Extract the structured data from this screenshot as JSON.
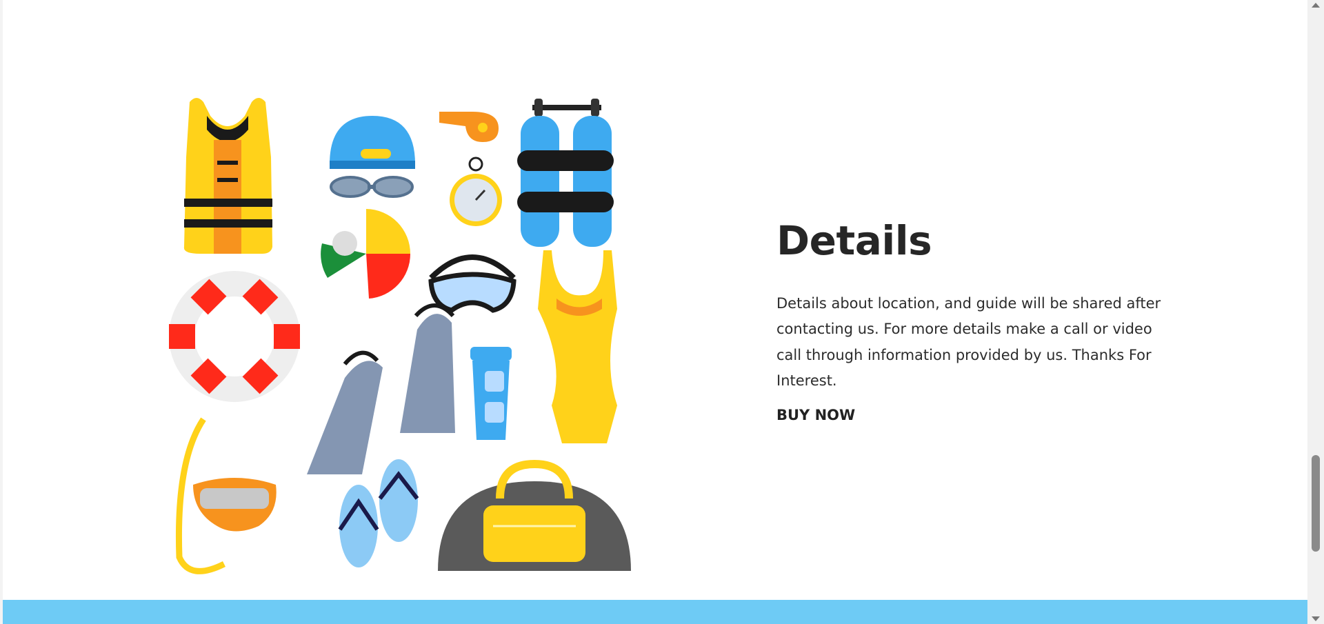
{
  "details": {
    "title": "Details",
    "body": "Details about location, and guide will be shared after contacting us. For more details make a call or video call through information provided by us. Thanks For Interest.",
    "cta_label": "BUY NOW"
  },
  "illustration": {
    "icons": [
      "life-vest-icon",
      "swim-cap-icon",
      "goggles-icon",
      "whistle-icon",
      "stopwatch-icon",
      "scuba-tanks-icon",
      "beach-ball-icon",
      "swim-mask-icon",
      "swimsuit-icon",
      "life-ring-icon",
      "fins-icon",
      "water-bottle-icon",
      "snorkel-icon",
      "flip-flops-icon",
      "duffel-bag-icon"
    ]
  },
  "colors": {
    "footer_band": "#6ecbf5",
    "title": "#262626"
  }
}
